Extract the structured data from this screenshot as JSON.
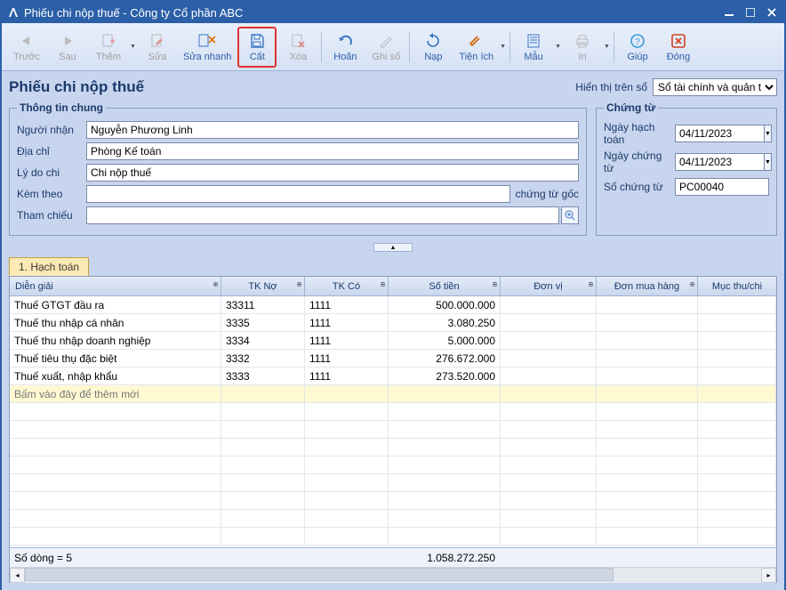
{
  "window": {
    "title": "Phiếu chi nộp thuế - Công ty Cổ phần ABC"
  },
  "toolbar": {
    "prev": "Trước",
    "next": "Sau",
    "add": "Thêm",
    "edit": "Sửa",
    "quickEdit": "Sửa nhanh",
    "save": "Cất",
    "delete": "Xóa",
    "undo": "Hoãn",
    "post": "Ghi sổ",
    "reload": "Nạp",
    "utility": "Tiện ích",
    "template": "Mẫu",
    "print": "In",
    "help": "Giúp",
    "close": "Đóng"
  },
  "page": {
    "title": "Phiếu chi nộp thuế",
    "displayOnLabel": "Hiển thị trên sổ",
    "displayOnValue": "Sổ tài chính và quản trị"
  },
  "general": {
    "legend": "Thông tin chung",
    "recipientLabel": "Người nhận",
    "recipient": "Nguyễn Phương Linh",
    "addressLabel": "Địa chỉ",
    "address": "Phòng Kế toán",
    "reasonLabel": "Lý do chi",
    "reason": "Chi nộp thuế",
    "attachLabel": "Kèm theo",
    "attach": "",
    "attachSuffix": "chứng từ gốc",
    "refLabel": "Tham chiếu"
  },
  "voucher": {
    "legend": "Chứng từ",
    "postDateLabel": "Ngày hạch toán",
    "postDate": "04/11/2023",
    "voucherDateLabel": "Ngày chứng từ",
    "voucherDate": "04/11/2023",
    "voucherNoLabel": "Số chứng từ",
    "voucherNo": "PC00040"
  },
  "tab1": "1. Hạch toán",
  "cols": {
    "desc": "Diễn giải",
    "debit": "TK Nợ",
    "credit": "TK Có",
    "amount": "Số tiền",
    "unit": "Đơn vị",
    "po": "Đơn mua hàng",
    "item": "Mục thu/chi"
  },
  "rows": [
    {
      "d": "Thuế GTGT đầu ra",
      "n": "33311",
      "c": "1111",
      "a": "500.000.000"
    },
    {
      "d": "Thuế thu nhập cá nhân",
      "n": "3335",
      "c": "1111",
      "a": "3.080.250"
    },
    {
      "d": "Thuế thu nhập doanh nghiệp",
      "n": "3334",
      "c": "1111",
      "a": "5.000.000"
    },
    {
      "d": "Thuế tiêu thụ đặc biệt",
      "n": "3332",
      "c": "1111",
      "a": "276.672.000"
    },
    {
      "d": "Thuế xuất, nhập khẩu",
      "n": "3333",
      "c": "1111",
      "a": "273.520.000"
    }
  ],
  "newRowHint": "Bấm vào đây để thêm mới",
  "footer": {
    "rowCount": "Số dòng = 5",
    "total": "1.058.272.250"
  }
}
